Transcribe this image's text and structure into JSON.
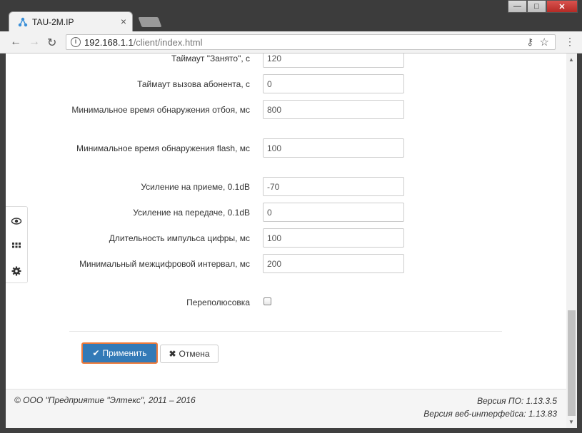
{
  "browser": {
    "tab_title": "TAU-2M.IP",
    "tab_close": "×",
    "url_host": "192.168.1.1",
    "url_path": "/client/index.html",
    "window_buttons": {
      "minimize": "—",
      "maximize": "□",
      "close": "✕"
    }
  },
  "sidebar_icons": [
    "eye-icon",
    "grid-icon",
    "gear-icon"
  ],
  "form": {
    "fields": [
      {
        "label": "Таймаут \"Занято\", с",
        "value": "120"
      },
      {
        "label": "Таймаут вызова абонента, с",
        "value": "0"
      },
      {
        "label": "Минимальное время обнаружения отбоя, мс",
        "value": "800"
      },
      {
        "label": "Минимальное время обнаружения flash, мс",
        "value": "100"
      },
      {
        "label": "Усиление на приеме, 0.1dB",
        "value": "-70"
      },
      {
        "label": "Усиление на передаче, 0.1dB",
        "value": "0"
      },
      {
        "label": "Длительность импульса цифры, мс",
        "value": "100"
      },
      {
        "label": "Минимальный межцифровой интервал, мс",
        "value": "200"
      }
    ],
    "checkbox": {
      "label": "Переполюсовка",
      "checked": false
    }
  },
  "buttons": {
    "apply": "Применить",
    "cancel": "Отмена"
  },
  "footer": {
    "copyright": "© ООО \"Предприятие \"Элтекс\", 2011 – 2016",
    "fw_version": "Версия ПО: 1.13.3.5",
    "web_version": "Версия веб-интерфейса: 1.13.83"
  },
  "colors": {
    "primary": "#337ab7",
    "focus_outline": "#ef7a3a"
  }
}
